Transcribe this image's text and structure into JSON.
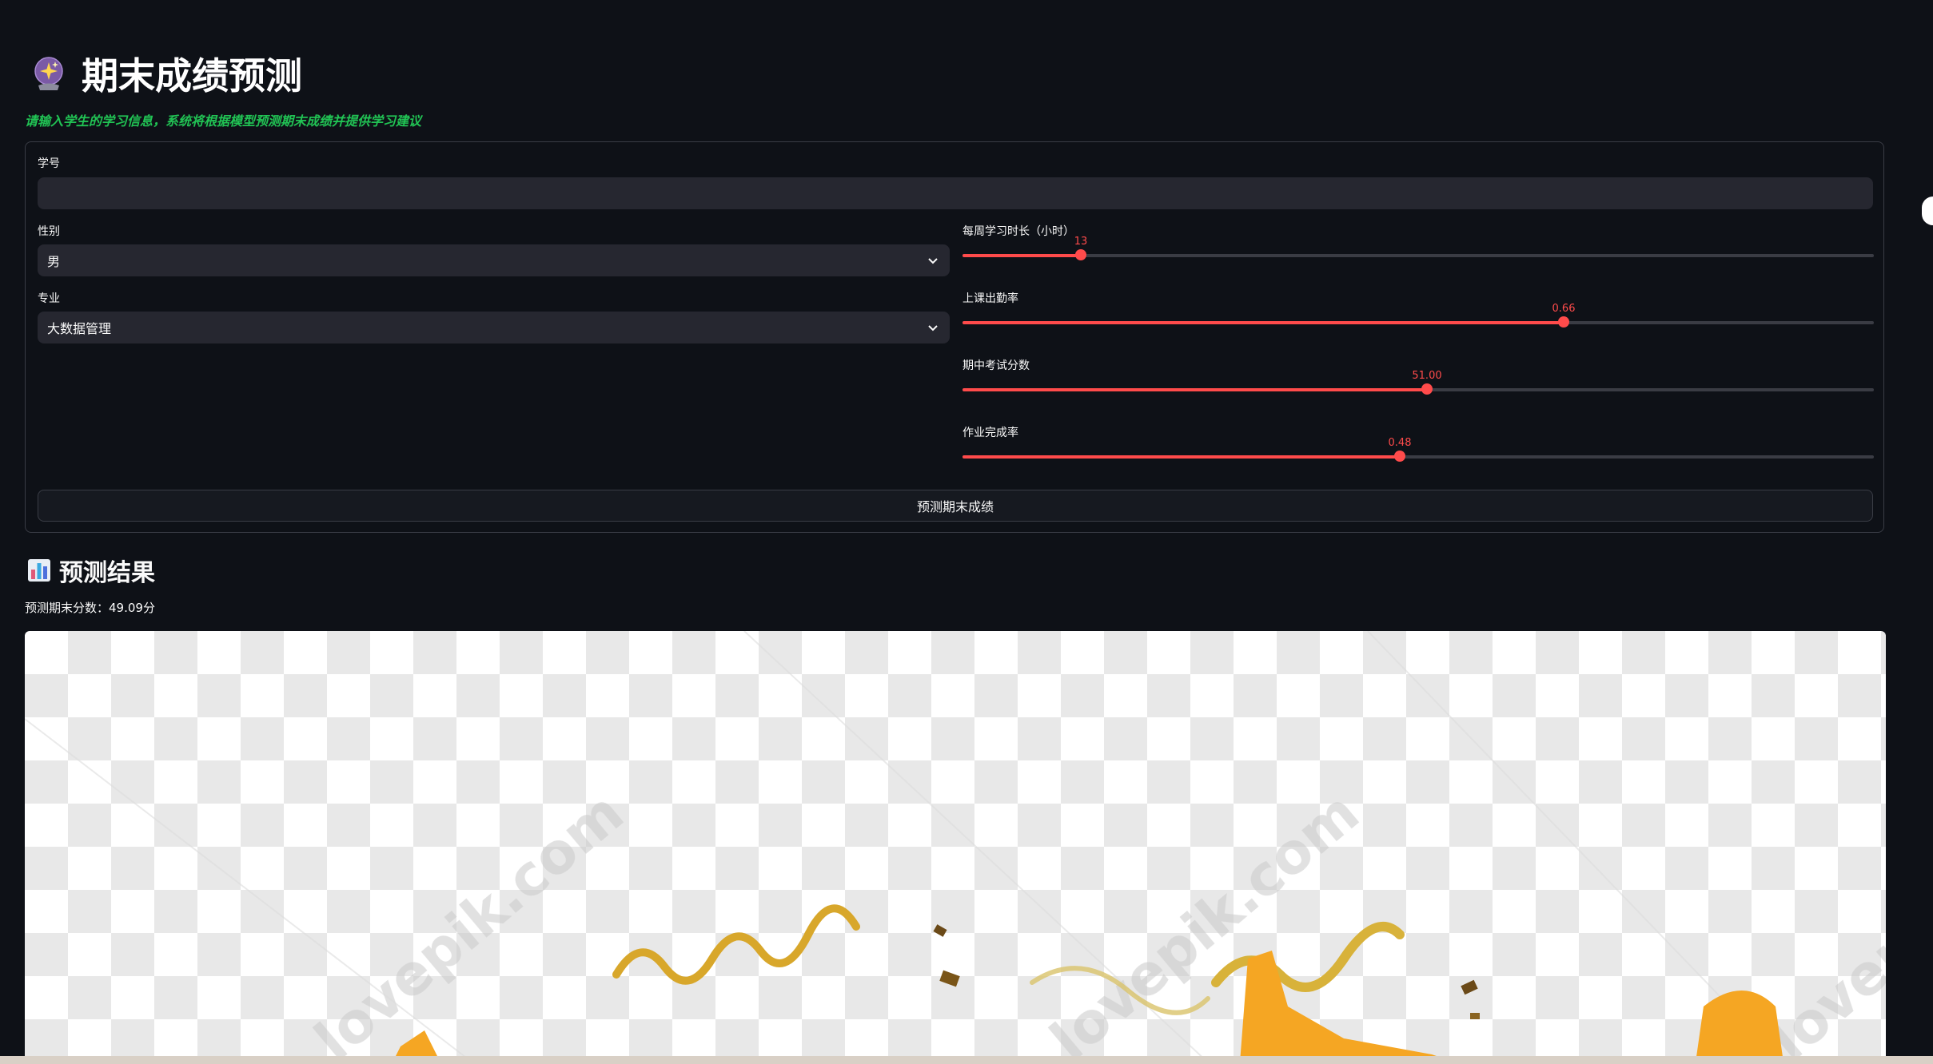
{
  "header": {
    "icon": "crystal-ball-icon",
    "title": "期末成绩预测",
    "subtitle": "请输入学生的学习信息，系统将根据模型预测期末成绩并提供学习建议"
  },
  "form": {
    "student_id": {
      "label": "学号",
      "value": ""
    },
    "gender": {
      "label": "性别",
      "value": "男"
    },
    "major": {
      "label": "专业",
      "value": "大数据管理"
    },
    "sliders": [
      {
        "label": "每周学习时长（小时）",
        "value_text": "13",
        "fraction": 0.13
      },
      {
        "label": "上课出勤率",
        "value_text": "0.66",
        "fraction": 0.66
      },
      {
        "label": "期中考试分数",
        "value_text": "51.00",
        "fraction": 0.51
      },
      {
        "label": "作业完成率",
        "value_text": "0.48",
        "fraction": 0.48
      }
    ],
    "submit_label": "预测期末成绩"
  },
  "result": {
    "icon": "bar-chart-icon",
    "title": "预测结果",
    "score_text": "预测期末分数：49.09分"
  },
  "image": {
    "watermark": "lovepik.com",
    "colors": {
      "accent": "#ff4b4b",
      "subtitle": "#21c354",
      "background": "#0e1117"
    }
  }
}
